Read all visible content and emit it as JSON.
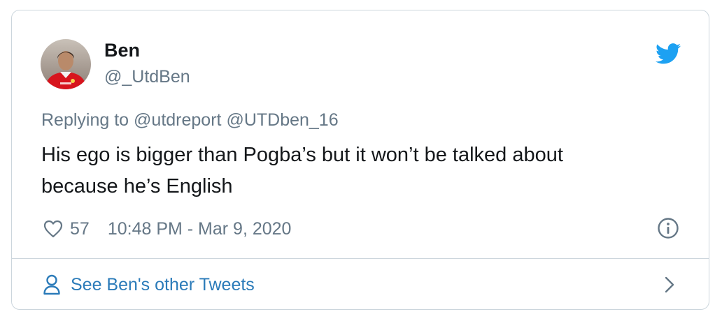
{
  "author": {
    "name": "Ben",
    "handle": "@_UtdBen"
  },
  "reply": {
    "prefix": "Replying to",
    "mentions": [
      "@utdreport",
      "@UTDben_16"
    ]
  },
  "tweet": {
    "text_line1": "His ego is bigger than Pogba’s but it won’t be talked about",
    "text_line2": "because he’s English"
  },
  "meta": {
    "likes": "57",
    "timestamp": "10:48 PM - Mar 9, 2020"
  },
  "footer": {
    "other_tweets_label": "See Ben's other Tweets"
  },
  "icons": {
    "brand": "twitter-bird-icon",
    "like": "heart-icon",
    "info": "info-icon",
    "person": "person-icon",
    "chevron": "chevron-right-icon"
  },
  "colors": {
    "brand": "#1da1f2",
    "link": "#2b7bb9",
    "secondary_text": "#657786",
    "border": "#ccd6dd"
  }
}
